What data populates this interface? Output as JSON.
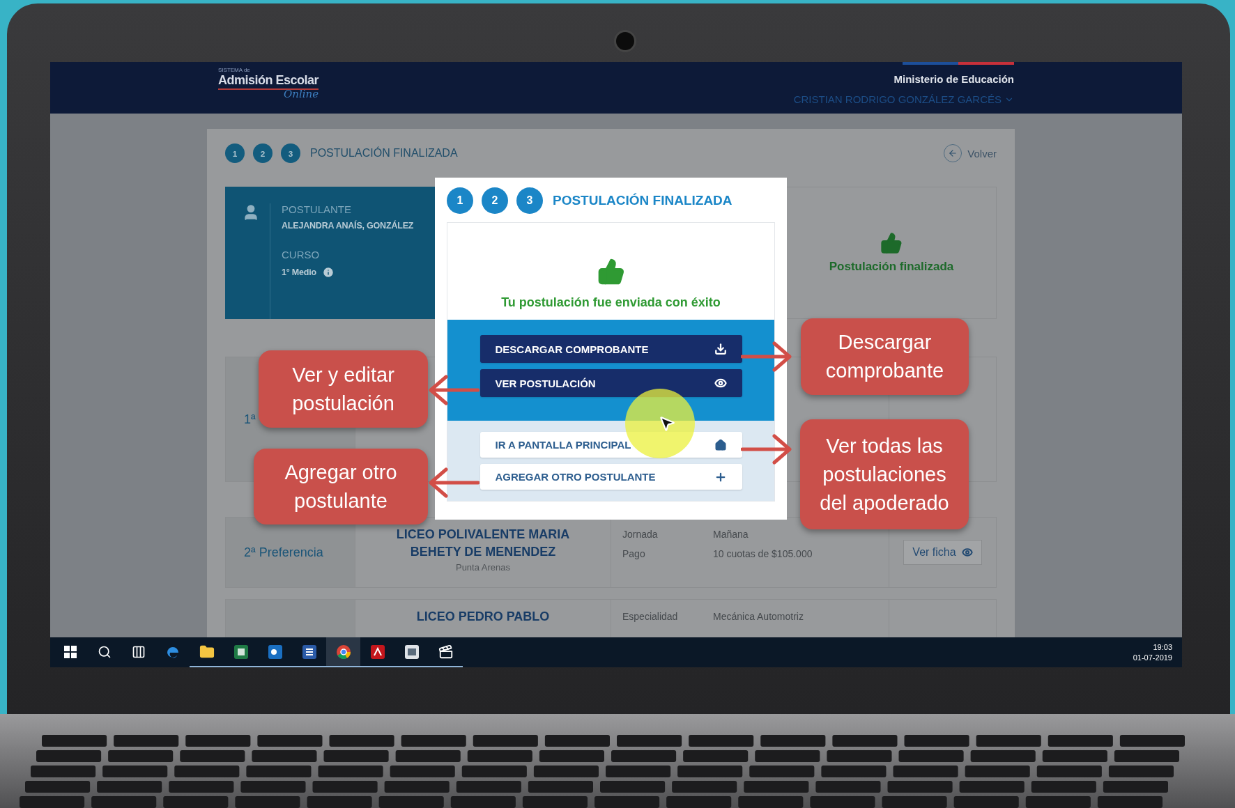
{
  "header": {
    "logo": {
      "small": "SISTEMA de",
      "main": "Admisión Escolar",
      "script": "Online"
    },
    "ministry": "Ministerio de Educación",
    "user": "CRISTIAN RODRIGO GONZÁLEZ GARCÉS"
  },
  "steps": {
    "numbers": [
      "1",
      "2",
      "3"
    ],
    "title": "POSTULACIÓN FINALIZADA",
    "back": "Volver"
  },
  "applicant": {
    "fields": [
      {
        "label": "POSTULANTE",
        "value": "ALEJANDRA ANAÍS, GONZÁLEZ",
        "info": false
      },
      {
        "label": "CURSO",
        "value": "1° Medio",
        "info": true
      }
    ]
  },
  "status": "Postulación finalizada",
  "preferences": [
    {
      "rank": "1ª"
    },
    {
      "rank": "2ª Preferencia",
      "school": "LICEO POLIVALENTE MARIA",
      "school_2": "BEHETY DE MENENDEZ",
      "city": "Punta Arenas",
      "details": [
        {
          "label": "Jornada",
          "value": "Mañana"
        },
        {
          "label": "Pago",
          "value": "10 cuotas de $105.000"
        }
      ],
      "action": "Ver ficha"
    },
    {
      "school": "LICEO PEDRO PABLO",
      "details": [
        {
          "label": "Especialidad",
          "value": "Mecánica Automotriz"
        }
      ]
    }
  ],
  "modal": {
    "numbers": [
      "1",
      "2",
      "3"
    ],
    "title": "POSTULACIÓN FINALIZADA",
    "message": "Tu postulación fue enviada con éxito",
    "primary_actions": [
      {
        "label": "DESCARGAR COMPROBANTE",
        "kind": "download"
      },
      {
        "label": "VER POSTULACIÓN",
        "kind": "view"
      }
    ],
    "secondary_actions": [
      {
        "label": "IR A PANTALLA PRINCIPAL",
        "kind": "home"
      },
      {
        "label": "AGREGAR OTRO POSTULANTE",
        "kind": "add"
      }
    ]
  },
  "callouts": [
    {
      "text": "Ver y editar postulación",
      "kind": "left"
    },
    {
      "text": "Agregar otro postulante",
      "kind": "left"
    },
    {
      "text": "Descargar comprobante",
      "kind": "right"
    },
    {
      "text": "Ver todas las postulaciones del apoderado",
      "kind": "right"
    }
  ],
  "taskbar": {
    "apps": [
      {
        "kind": "start",
        "open": false,
        "selected": false
      },
      {
        "kind": "search",
        "open": false,
        "selected": false
      },
      {
        "kind": "taskview",
        "open": false,
        "selected": false
      },
      {
        "kind": "edge",
        "open": false,
        "selected": false
      },
      {
        "kind": "explorer",
        "open": true,
        "selected": false
      },
      {
        "kind": "excel",
        "open": true,
        "selected": false
      },
      {
        "kind": "outlook",
        "open": true,
        "selected": false
      },
      {
        "kind": "word",
        "open": true,
        "selected": false
      },
      {
        "kind": "chrome",
        "open": true,
        "selected": true
      },
      {
        "kind": "acrobat",
        "open": true,
        "selected": false
      },
      {
        "kind": "photos",
        "open": true,
        "selected": false
      },
      {
        "kind": "clapper",
        "open": true,
        "selected": false
      }
    ],
    "time": "19:03",
    "date": "01-07-2019"
  }
}
